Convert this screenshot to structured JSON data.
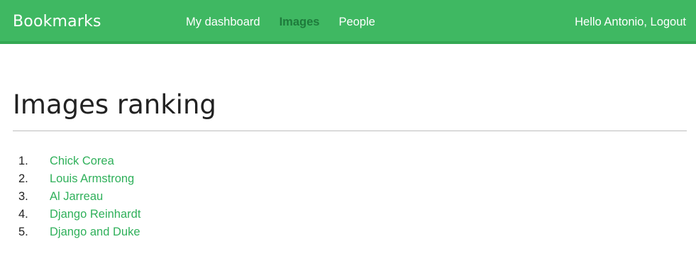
{
  "header": {
    "logo": "Bookmarks",
    "nav": [
      {
        "label": "My dashboard",
        "active": false
      },
      {
        "label": "Images",
        "active": true
      },
      {
        "label": "People",
        "active": false
      }
    ],
    "greeting": "Hello Antonio,",
    "logout_label": "Logout"
  },
  "main": {
    "title": "Images ranking",
    "ranking": [
      {
        "number": "1.",
        "label": "Chick Corea"
      },
      {
        "number": "2.",
        "label": "Louis Armstrong"
      },
      {
        "number": "3.",
        "label": "Al Jarreau"
      },
      {
        "number": "4.",
        "label": "Django Reinhardt"
      },
      {
        "number": "5.",
        "label": "Django and Duke"
      }
    ]
  },
  "colors": {
    "header_bg": "#3fb862",
    "nav_active": "#1e7a3b",
    "link": "#2fb05a"
  }
}
